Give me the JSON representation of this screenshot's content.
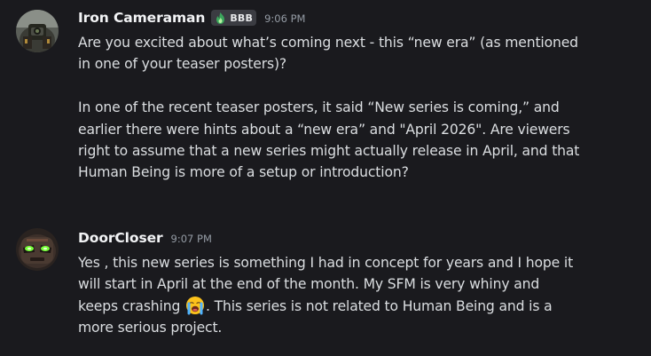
{
  "messages": [
    {
      "author": "Iron Cameraman",
      "tag": "BBB",
      "tag_icon": "green-flame-icon",
      "time": "9:06 PM",
      "lines": [
        "Are you excited about what’s coming next - this “new era” (as mentioned",
        "in one of your teaser posters)?",
        "",
        "In one of the recent teaser posters, it said “New series is coming,” and",
        "earlier there were hints about a “new era” and \"April 2026\". Are viewers",
        "right to assume that a new series might actually release in April, and that",
        "Human Being is more of a setup or introduction?"
      ]
    },
    {
      "author": "DoorCloser",
      "time": "9:07 PM",
      "lines": [
        "Yes , this new series is something I had in concept for years and I hope it",
        "will start in April at the end of the month. My SFM is very whiny and"
      ],
      "line3_before_emoji": "keeps crashing ",
      "emoji": "loudly-crying-face-emoji",
      "line3_after_emoji": ". This series is not related to Human Being and is a",
      "line4": "more serious project."
    }
  ],
  "colors": {
    "background": "#1a1a1e",
    "username": "#f2f3f5",
    "text": "#dbdee1",
    "timestamp": "#949ba4",
    "tag_background": "#3b3c42",
    "tag_icon": "#3ba55c"
  }
}
